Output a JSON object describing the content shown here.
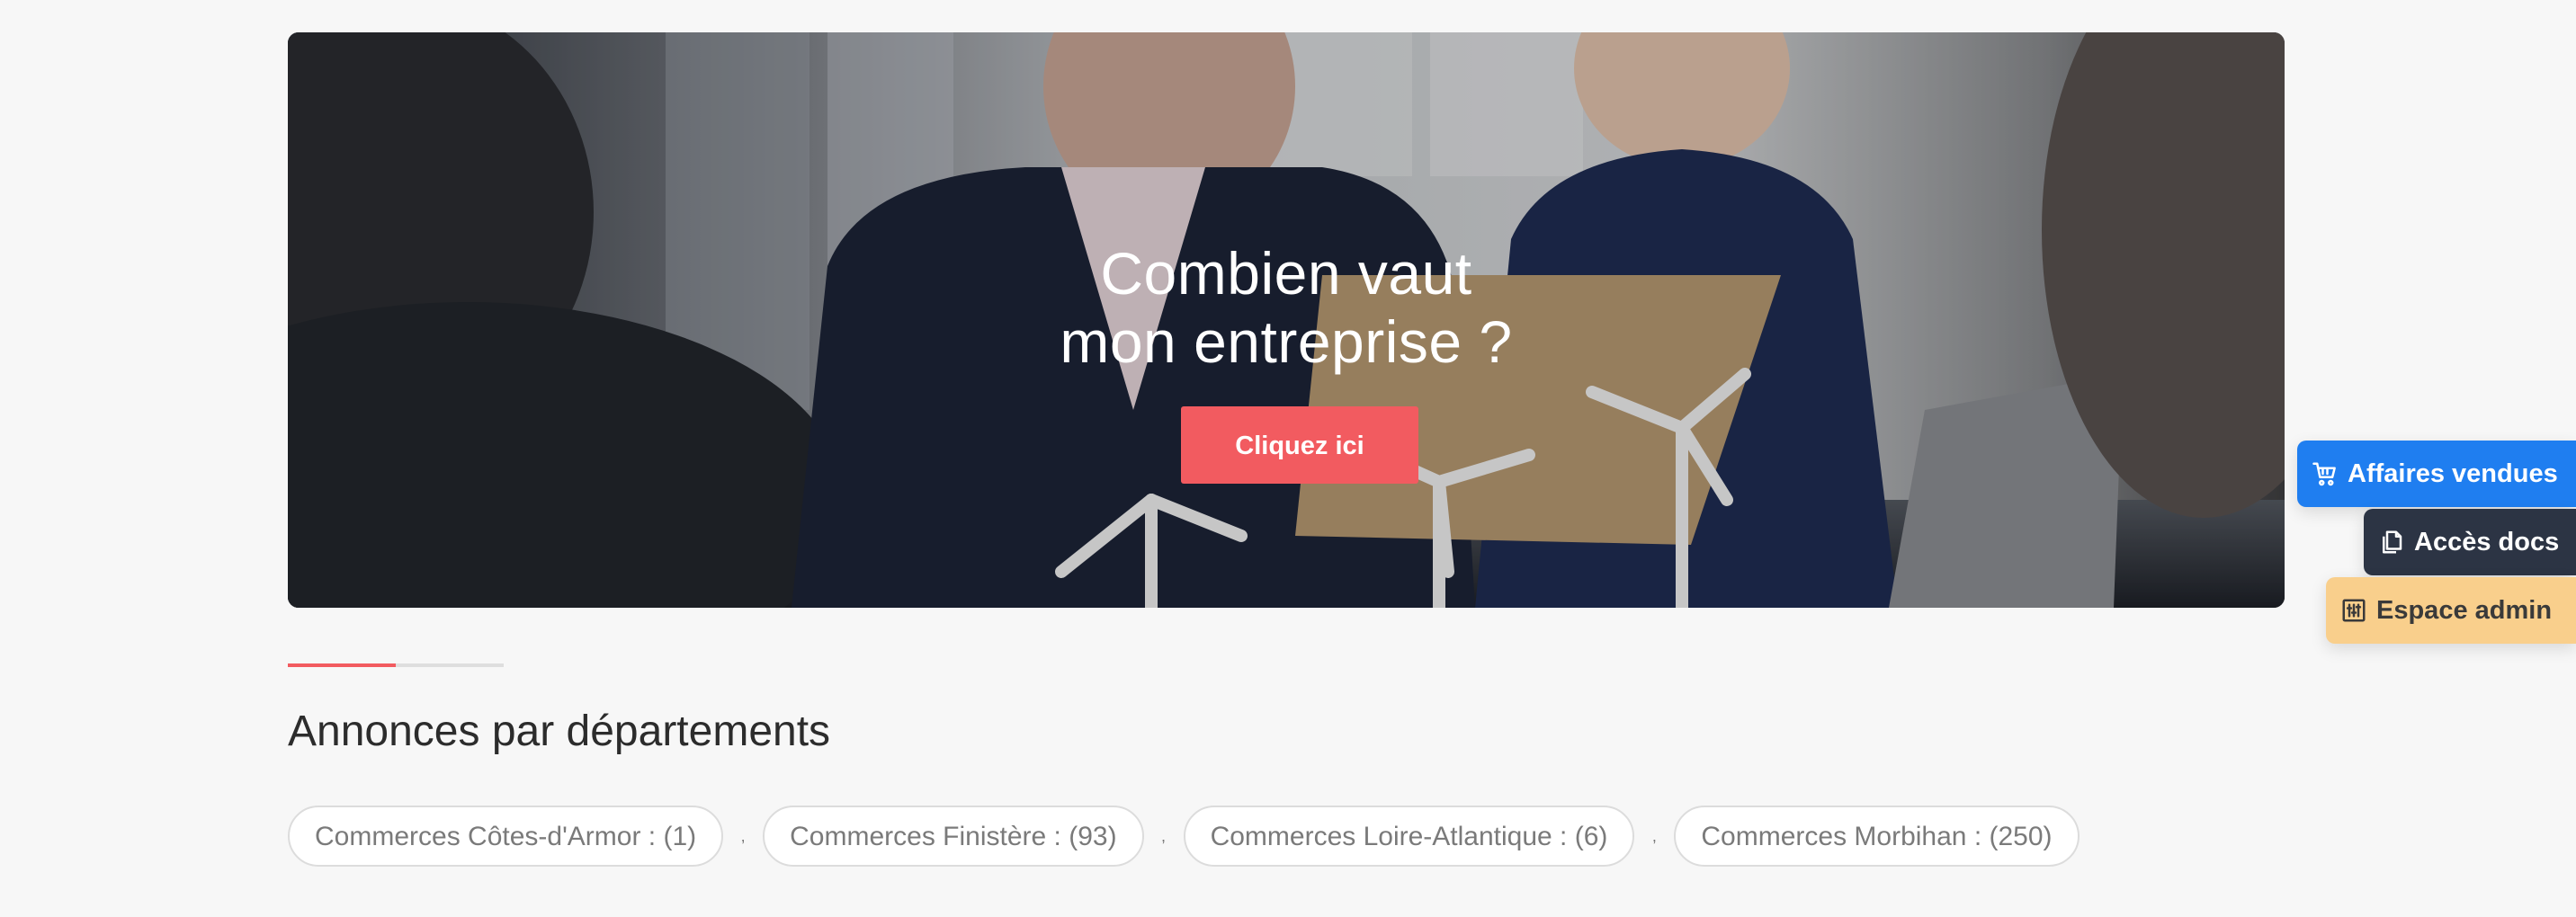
{
  "hero": {
    "title_line1": "Combien vaut",
    "title_line2": "mon entreprise ?",
    "cta_label": "Cliquez ici"
  },
  "section": {
    "title": "Annonces par départements",
    "chips": [
      {
        "label": "Commerces Côtes-d'Armor : (1)"
      },
      {
        "label": "Commerces Finistère : (93)"
      },
      {
        "label": "Commerces Loire-Atlantique : (6)"
      },
      {
        "label": "Commerces Morbihan : (250)"
      }
    ]
  },
  "side_buttons": {
    "sold": {
      "label": "Affaires vendues",
      "icon": "cart-icon",
      "color": "#1f7ef0"
    },
    "docs": {
      "label": "Accès docs",
      "icon": "documents-icon",
      "color": "#2c3444"
    },
    "admin": {
      "label": "Espace admin",
      "icon": "sliders-icon",
      "color": "#f9cf8c"
    }
  },
  "colors": {
    "accent": "#f25b60",
    "background": "#f7f7f7"
  }
}
